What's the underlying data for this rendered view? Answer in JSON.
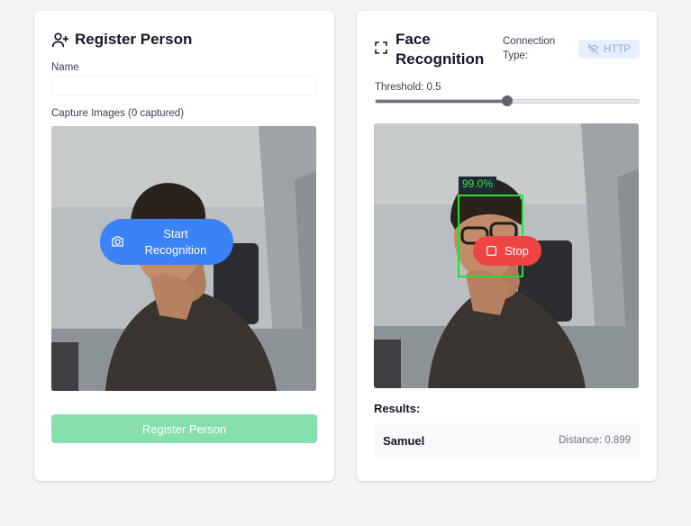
{
  "register": {
    "title": "Register Person",
    "name_label": "Name",
    "name_value": "",
    "name_placeholder": "",
    "capture_label": "Capture Images (0 captured)",
    "start_button": "Start Recognition",
    "register_button": "Register Person"
  },
  "recognition": {
    "title": "Face Recognition",
    "connection_label": "Connection Type:",
    "connection_value": "HTTP",
    "threshold_label": "Threshold: 0.5",
    "threshold_value": 0.5,
    "detection_confidence": "99.0%",
    "stop_button": "Stop",
    "results_title": "Results:",
    "results": [
      {
        "name": "Samuel",
        "distance": "Distance: 0.899"
      }
    ]
  },
  "colors": {
    "primary": "#3b82f6",
    "danger": "#ef4444",
    "success_disabled": "#86dfad",
    "detection": "#22e032"
  },
  "icons": {
    "register": "user-plus-icon",
    "recognition": "scan-frame-icon",
    "connection": "wifi-off-icon",
    "start": "camera-icon",
    "stop": "stop-square-icon"
  }
}
